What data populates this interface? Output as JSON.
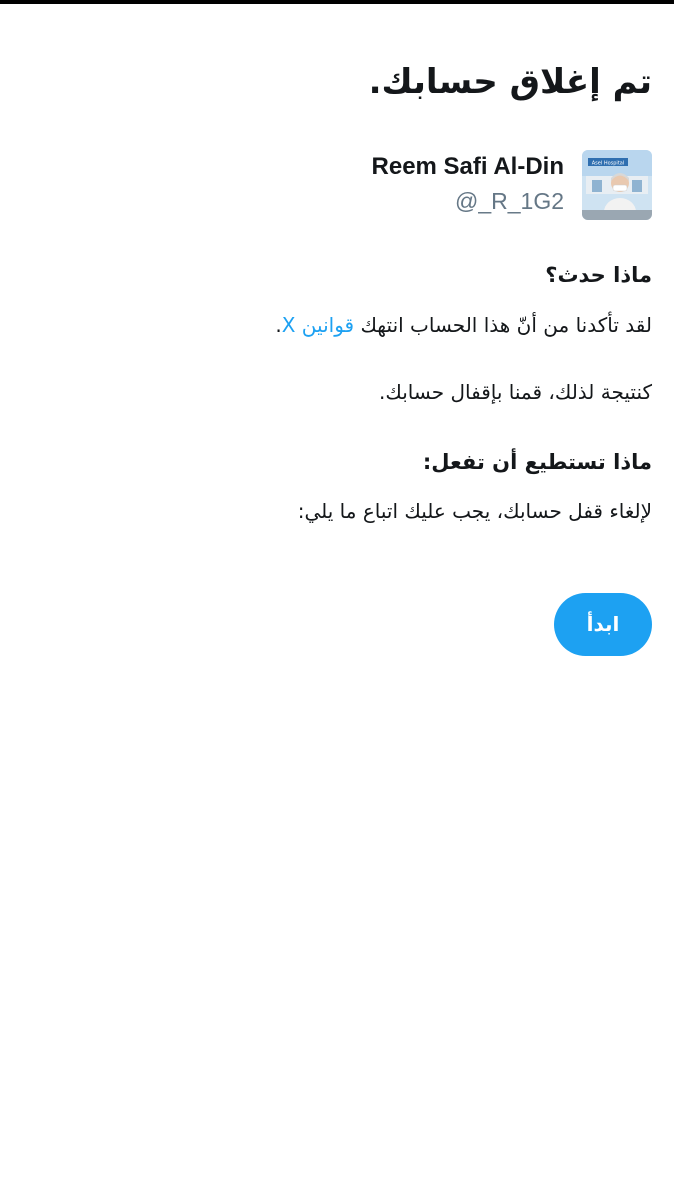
{
  "page": {
    "title": "تم إغلاق حسابك."
  },
  "profile": {
    "display_name": "Reem Safi Al-Din",
    "handle": "@_R_1G2",
    "avatar_sign_text": "Asel Hospital"
  },
  "section_what_happened": {
    "heading": "ماذا حدث؟",
    "line1_text": "لقد تأكدنا من أنّ هذا الحساب انتهك",
    "line1_link": "قوانين X",
    "line1_end": ".",
    "line2": "كنتيجة لذلك، قمنا بإقفال حسابك."
  },
  "section_what_to_do": {
    "heading": "ماذا تستطيع أن تفعل:",
    "line1": "لإلغاء قفل حسابك، يجب عليك اتباع ما يلي:"
  },
  "actions": {
    "start_label": "ابدأ"
  },
  "colors": {
    "accent": "#1da1f2",
    "text": "#14171a",
    "muted": "#657786"
  }
}
